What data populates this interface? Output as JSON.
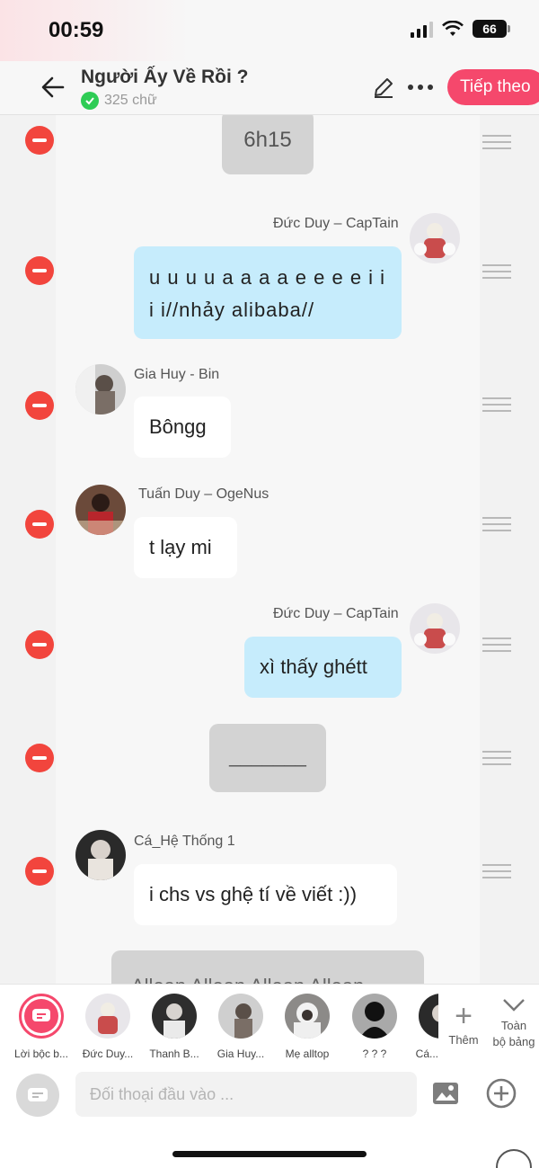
{
  "status_bar": {
    "time": "00:59",
    "battery": "66"
  },
  "header": {
    "back_icon": "arrow-left-icon",
    "title": "Người Ấy Về Rồi ?",
    "word_count": "325 chữ",
    "next_label": "Tiếp theo"
  },
  "messages": [
    {
      "type": "narration",
      "text": "6h15"
    },
    {
      "type": "right",
      "sender": "Đức Duy – CapTain",
      "line1": "u u u u a a a a e e e e i i",
      "line2": "i i//nhảy alibaba//"
    },
    {
      "type": "left",
      "sender": "Gia Huy - Bin",
      "text": "Bôngg"
    },
    {
      "type": "left",
      "sender": "Tuấn Duy – OgeNus",
      "text": "t lạy mi"
    },
    {
      "type": "right",
      "sender": "Đức Duy – CapTain",
      "text": "xì thấy ghétt"
    },
    {
      "type": "narration",
      "text": "_______"
    },
    {
      "type": "left",
      "sender": "Cá_Hệ Thống 1",
      "text": "i chs vs ghệ tí về viết :))"
    },
    {
      "type": "narration",
      "text": "Allean Allean Allean Allean"
    }
  ],
  "characters": [
    {
      "label": "Lời bộc b...",
      "selected": true
    },
    {
      "label": "Đức Duy..."
    },
    {
      "label": "Thanh B..."
    },
    {
      "label": "Gia Huy..."
    },
    {
      "label": "Mẹ alltop"
    },
    {
      "label": "? ? ?"
    },
    {
      "label": "Cá..."
    }
  ],
  "strip_actions": {
    "add_label": "Thêm",
    "expand_line1": "Toàn",
    "expand_line2": "bộ bảng"
  },
  "input": {
    "placeholder": "Đối thoại đầu vào ..."
  },
  "colors": {
    "accent": "#f5486c",
    "remove": "#f2453d",
    "bubble_right": "#c6ecfc",
    "bubble_narration": "#d3d3d3"
  }
}
